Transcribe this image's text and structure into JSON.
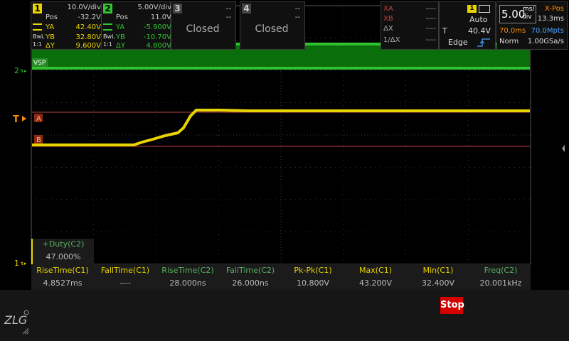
{
  "markers": {
    "vsp_label": "VSP",
    "ch2_marker": "2",
    "trigger_marker": "T",
    "ch1_marker": "1",
    "cursor_a": "A",
    "cursor_b": "B"
  },
  "duty": {
    "name": "+Duty(C2)",
    "value": "47.000%"
  },
  "measurements": [
    {
      "name": "RiseTime(C1)",
      "value": "4.8527ms",
      "channel": "C1"
    },
    {
      "name": "FallTime(C1)",
      "value": "----",
      "channel": "C1"
    },
    {
      "name": "RiseTime(C2)",
      "value": "28.000ns",
      "channel": "C2"
    },
    {
      "name": "FallTime(C2)",
      "value": "26.000ns",
      "channel": "C2"
    },
    {
      "name": "Pk-Pk(C1)",
      "value": "10.800V",
      "channel": "C1"
    },
    {
      "name": "Max(C1)",
      "value": "43.200V",
      "channel": "C1"
    },
    {
      "name": "Min(C1)",
      "value": "32.400V",
      "channel": "C1"
    },
    {
      "name": "Freq(C2)",
      "value": "20.001kHz",
      "channel": "C2"
    }
  ],
  "ch1": {
    "num": "1",
    "scale": "10.0V/div",
    "pos_label": "Pos",
    "pos": "-32.2V",
    "ya_label": "YA",
    "ya": "42.40V",
    "yb_label": "YB",
    "yb": "32.80V",
    "dy_label": "ΔY",
    "dy": "9.600V",
    "bw": "BwL",
    "coupling": "1:1"
  },
  "ch2": {
    "num": "2",
    "scale": "5.00V/div",
    "pos_label": "Pos",
    "pos": "11.0V",
    "ya_label": "YA",
    "ya": "-5.900V",
    "yb_label": "YB",
    "yb": "-10.70V",
    "dy_label": "ΔY",
    "dy": "4.800V",
    "bw": "BwL",
    "coupling": "1:1"
  },
  "ch3": {
    "num": "3",
    "status": "Closed",
    "dash": "--"
  },
  "ch4": {
    "num": "4",
    "status": "Closed",
    "dash": "--"
  },
  "cursors": {
    "xa_label": "XA",
    "xa": "----",
    "xb_label": "XB",
    "xb": "----",
    "dx_label": "ΔX",
    "dx": "----",
    "inv_dx_label": "1/ΔX",
    "inv_dx": "----"
  },
  "run": {
    "state": "Stop"
  },
  "trigger": {
    "source": "1",
    "mode": "Auto",
    "label": "T",
    "level": "40.4V",
    "type": "Edge"
  },
  "timebase": {
    "value": "5.00",
    "unit_top": "ms/",
    "unit_bottom": "div",
    "xpos_label": "X-Pos",
    "xpos": "13.3ms",
    "rec_time": "70.0ms",
    "rec_len": "70.0Mpts",
    "acq_mode": "Norm",
    "sample_rate": "1.00GSa/s"
  },
  "colors": {
    "ch1": "#e8d400",
    "ch2": "#2fc42f",
    "grid": "#3a3a3a",
    "cursor": "#c04040",
    "trigger": "#ff8c00"
  }
}
